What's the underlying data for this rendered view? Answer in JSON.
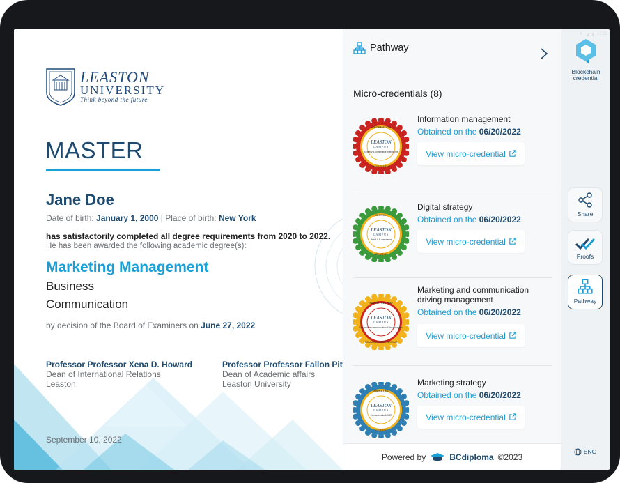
{
  "statusbar": {
    "time": "12:38"
  },
  "diploma": {
    "university": {
      "line1": "LEASTON",
      "line2": "UNIVERSITY",
      "tagline": "Think beyond the future"
    },
    "degree": "MASTER",
    "holder_name": "Jane Doe",
    "birth": {
      "dob_label": "Date of birth:",
      "dob": "January 1, 2000",
      "separator": " | ",
      "pob_label": "Place of birth:",
      "pob": "New York"
    },
    "completed_text": "has satisfactorily completed all degree requirements from 2020 to 2022.",
    "awarded_text": "He has been awarded the following academic degree(s):",
    "program": "Marketing Management",
    "specializations": [
      "Business",
      "Communication"
    ],
    "decision": {
      "text": "by decision of the Board of Examiners on",
      "date": "June 27, 2022"
    },
    "signatories": [
      {
        "name": "Professor Professor Xena D. Howard",
        "title": "Dean of International Relations",
        "org": "Leaston"
      },
      {
        "name": "Professor Professor Fallon Pittman",
        "title": "Dean of Academic affairs",
        "org": "Leaston University"
      }
    ],
    "issue_date": "September 10, 2022"
  },
  "panel": {
    "title": "Pathway",
    "mc_title": "Micro-credentials (8)",
    "obtained_prefix": "Obtained on the",
    "view_label": "View micro-credential",
    "items": [
      {
        "name": "Information management",
        "date": "06/20/2022",
        "badge_top": "INFORMATION",
        "badge_bottom": "MANAGEMENT",
        "badge_sub": "Strategy & competitive intelligence",
        "ring": "#c9241f",
        "accent": "#f2b21c"
      },
      {
        "name": "Digital strategy",
        "date": "06/20/2022",
        "badge_top": "DIGITAL",
        "badge_bottom": "STRATEGY",
        "badge_sub": "Retail & E-commerce",
        "ring": "#3a9a3c",
        "accent": "#f2b21c"
      },
      {
        "name": "Marketing and communication driving management",
        "date": "06/20/2022",
        "badge_top": "MARKETING AND",
        "badge_bottom": "COMMUNICATION DRIVING",
        "badge_sub": "Operational communication & business plan",
        "ring": "#f2b21c",
        "accent": "#c9241f"
      },
      {
        "name": "Marketing strategy",
        "date": "06/20/2022",
        "badge_top": "MARKETING",
        "badge_bottom": "STRATEGY",
        "badge_sub": "Fundamentals & CSR",
        "ring": "#2f7fb4",
        "accent": "#f2b21c"
      }
    ],
    "badge_brand": "LEASTON",
    "badge_campus": "CAMPUS",
    "footer": {
      "powered": "Powered by",
      "brand": "BCdiploma",
      "copyright": "©2023"
    }
  },
  "sidebar": {
    "logo_label": "Blockchain credential",
    "share": "Share",
    "proofs": "Proofs",
    "pathway": "Pathway",
    "lang": "ENG"
  },
  "colors": {
    "navy": "#1d4a6e",
    "accent_blue": "#1a9fd6"
  }
}
